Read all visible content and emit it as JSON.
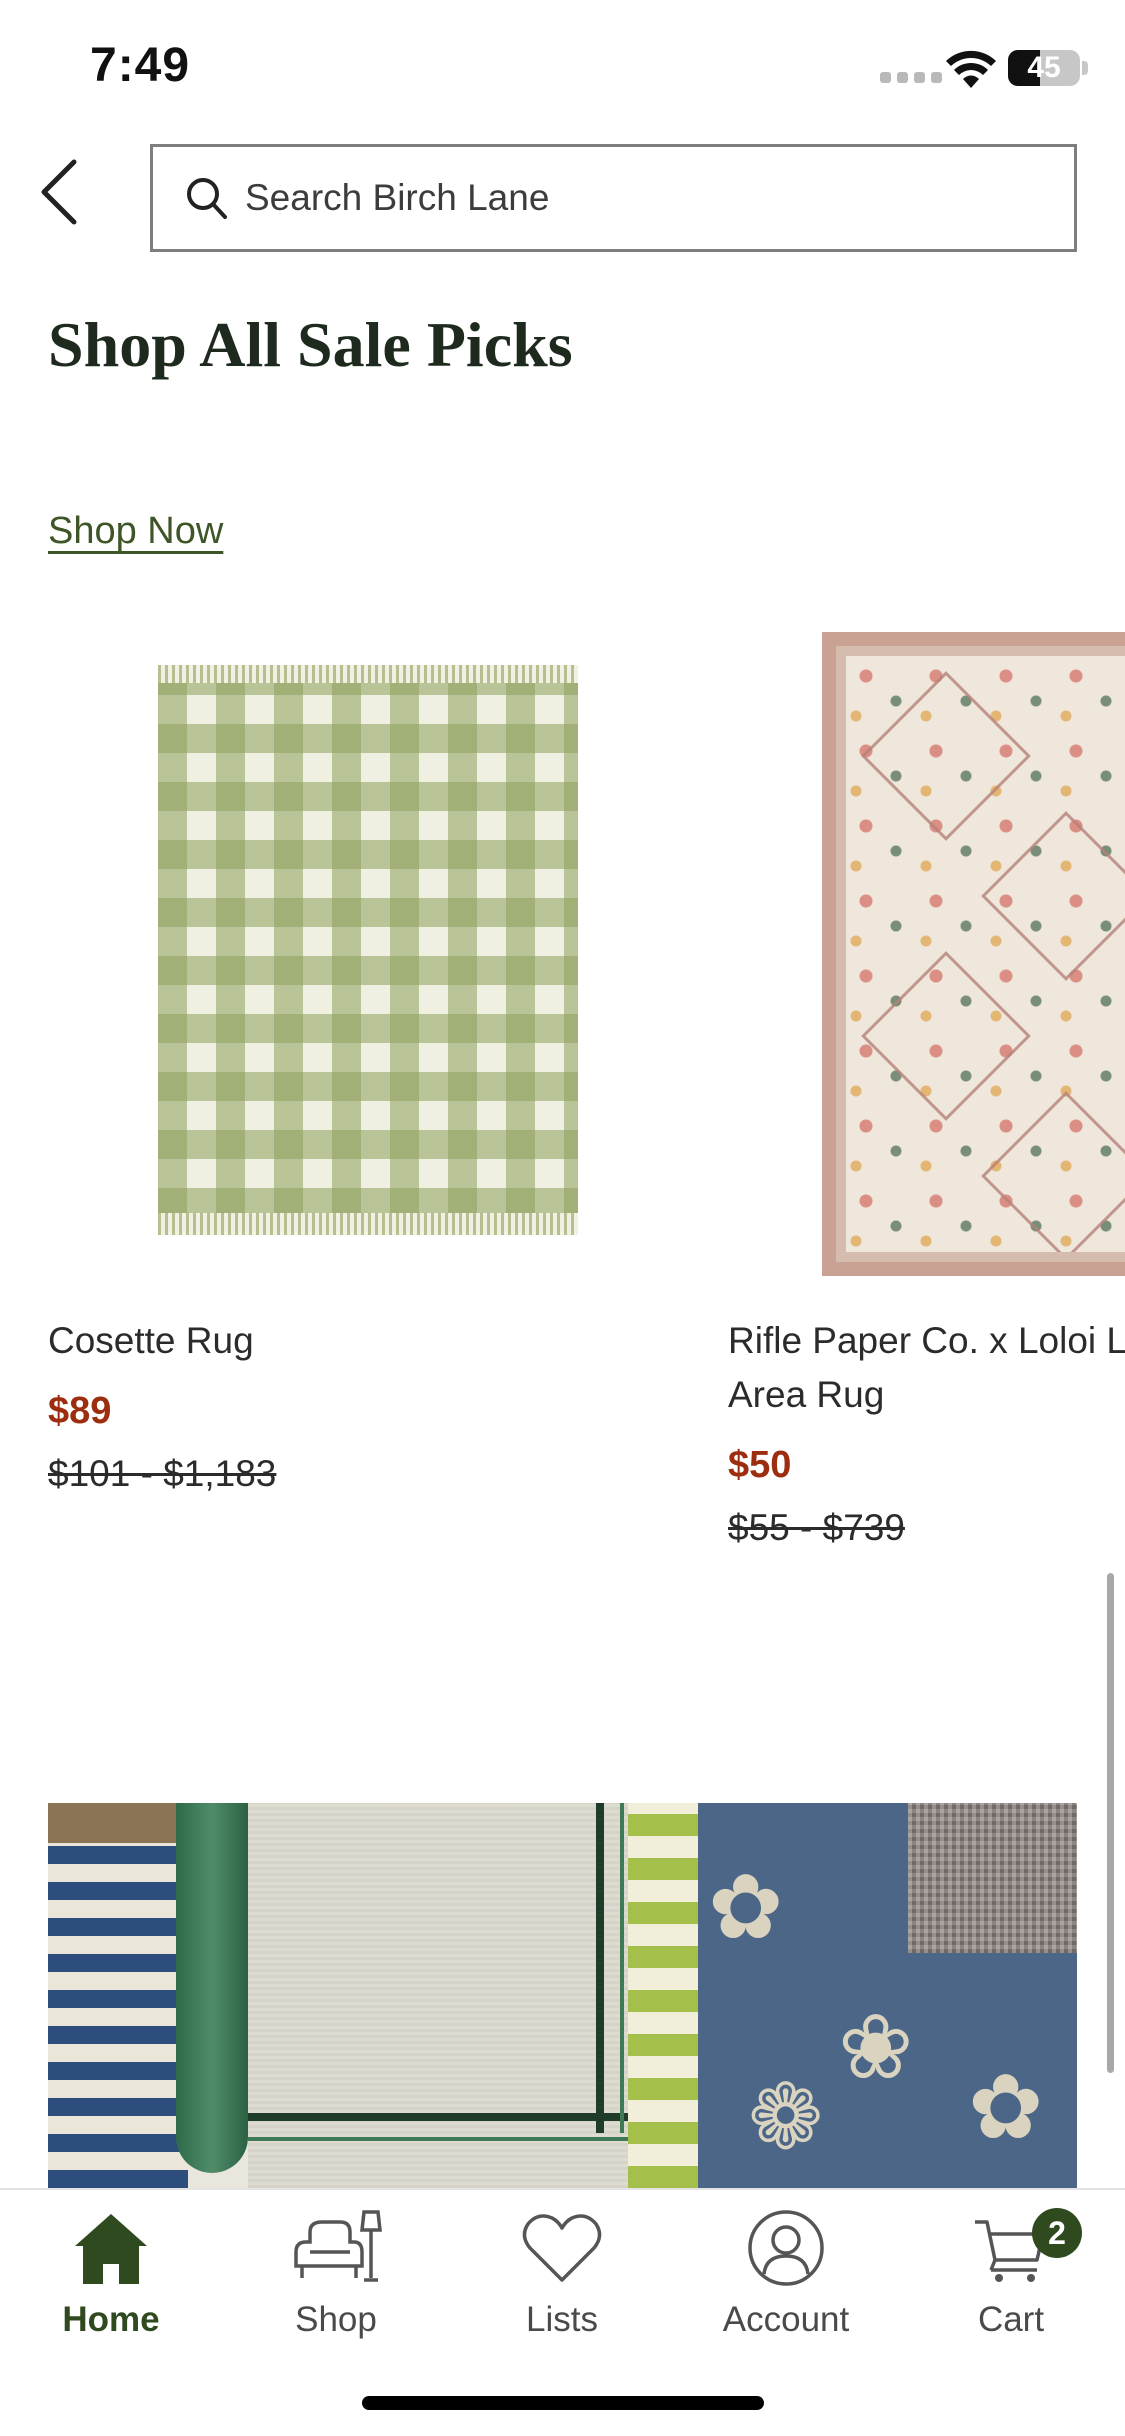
{
  "status_bar": {
    "time": "7:49",
    "battery": "45",
    "battery_level": 0.45,
    "icons": [
      "cellular-signal-icon",
      "wifi-icon",
      "battery-icon"
    ]
  },
  "header": {
    "back_icon": "chevron-left-icon",
    "search": {
      "icon": "search-icon",
      "placeholder": "Search Birch Lane",
      "value": ""
    }
  },
  "main": {
    "title": "Shop All Sale Picks",
    "shop_now_label": "Shop Now",
    "products": [
      {
        "name": "Cosette Rug",
        "sale_price": "$89",
        "original_price": "$101 - $1,183"
      },
      {
        "name_line1": "Rifle Paper Co. x Loloi L",
        "name_line2": "Area Rug",
        "sale_price": "$50",
        "original_price": "$55 - $739"
      }
    ]
  },
  "tab_bar": {
    "active": "Home",
    "tabs": [
      {
        "label": "Home",
        "icon": "home-icon"
      },
      {
        "label": "Shop",
        "icon": "chair-lamp-icon"
      },
      {
        "label": "Lists",
        "icon": "heart-icon"
      },
      {
        "label": "Account",
        "icon": "account-icon"
      },
      {
        "label": "Cart",
        "icon": "cart-icon",
        "badge": "2"
      }
    ]
  },
  "colors": {
    "accent_green": "#2f4a1f",
    "sale_red": "#9c2d0f",
    "link_green": "#3e5527"
  }
}
